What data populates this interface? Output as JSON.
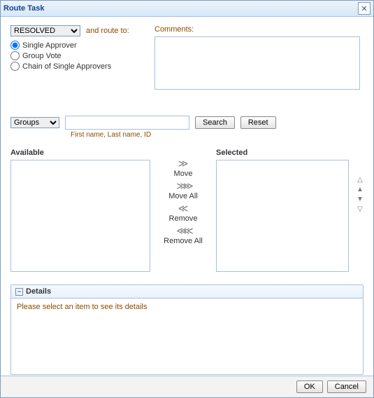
{
  "dialog": {
    "title": "Route Task"
  },
  "status": {
    "options": [
      "RESOLVED"
    ],
    "selected": "RESOLVED",
    "and_route_to": "and route to:"
  },
  "route_mode": {
    "options": [
      {
        "key": "single",
        "label": "Single Approver",
        "checked": true
      },
      {
        "key": "group",
        "label": "Group Vote",
        "checked": false
      },
      {
        "key": "chain",
        "label": "Chain of Single Approvers",
        "checked": false
      }
    ]
  },
  "comments": {
    "label": "Comments:",
    "value": ""
  },
  "search": {
    "scope_options": [
      "Groups"
    ],
    "scope_selected": "Groups",
    "value": "",
    "hint": "First name, Last name, ID",
    "search_btn": "Search",
    "reset_btn": "Reset"
  },
  "shuttle": {
    "available_label": "Available",
    "selected_label": "Selected",
    "move": "Move",
    "move_all": "Move All",
    "remove": "Remove",
    "remove_all": "Remove All",
    "available_items": [],
    "selected_items": []
  },
  "details": {
    "header": "Details",
    "placeholder": "Please select an item to see its details"
  },
  "footer": {
    "ok": "OK",
    "cancel": "Cancel"
  }
}
